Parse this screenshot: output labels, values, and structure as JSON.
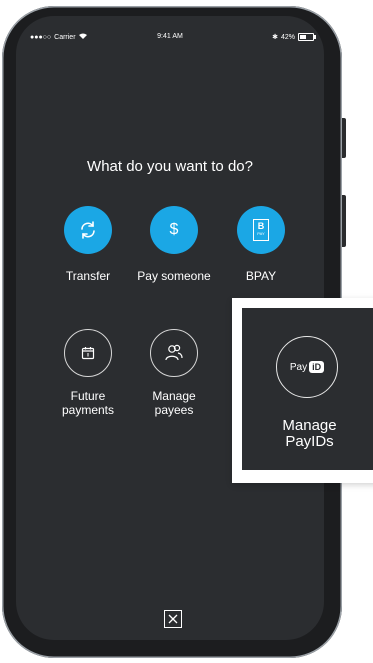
{
  "status_bar": {
    "carrier": "Carrier",
    "time": "9:41 AM",
    "battery": "42%"
  },
  "heading": "What do you want to do?",
  "actions": [
    {
      "label": "Transfer",
      "icon": "transfer-icon"
    },
    {
      "label": "Pay someone",
      "icon": "dollar-icon"
    },
    {
      "label": "BPAY",
      "icon": "bpay-icon",
      "icon_text": "PAY"
    },
    {
      "label": "Future\npayments",
      "icon": "calendar-icon"
    },
    {
      "label": "Manage\npayees",
      "icon": "people-icon"
    }
  ],
  "callout": {
    "label": "Manage\nPayIDs",
    "icon_text_pay": "Pay",
    "icon_text_id": "iD"
  },
  "colors": {
    "accent": "#1ba7e5",
    "screen_bg": "#2b2d30"
  }
}
